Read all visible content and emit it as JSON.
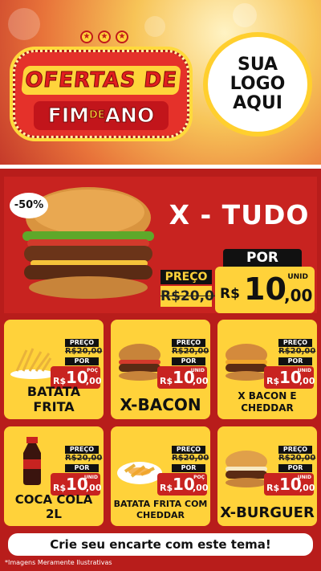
{
  "header": {
    "banner_line1": "OFERTAS DE",
    "banner_line2a": "FIM",
    "banner_de": "DE",
    "banner_line2b": "ANO",
    "logo": [
      "SUA",
      "LOGO",
      "AQUI"
    ]
  },
  "hero": {
    "discount": "-50%",
    "title": "X - TUDO",
    "preco_label": "PREÇO",
    "old_price": "R$20,00",
    "por_label": "POR",
    "currency": "R$",
    "price_int": "10",
    "price_dec": ",00",
    "unit": "UNID"
  },
  "products": [
    {
      "name": "BATATA FRITA",
      "preco_label": "PREÇO",
      "old_price": "R$20,00",
      "por_label": "POR",
      "currency": "R$",
      "price_int": "10",
      "price_dec": ",00",
      "unit": "POÇ"
    },
    {
      "name": "X-BACON",
      "preco_label": "PREÇO",
      "old_price": "R$20,00",
      "por_label": "POR",
      "currency": "R$",
      "price_int": "10",
      "price_dec": ",00",
      "unit": "UNID"
    },
    {
      "name": "X BACON E CHEDDAR",
      "preco_label": "PREÇO",
      "old_price": "R$20,00",
      "por_label": "POR",
      "currency": "R$",
      "price_int": "10",
      "price_dec": ",00",
      "unit": "UNID"
    },
    {
      "name": "COCA COLA 2L",
      "preco_label": "PREÇO",
      "old_price": "R$20,00",
      "por_label": "POR",
      "currency": "R$",
      "price_int": "10",
      "price_dec": ",00",
      "unit": "UNID"
    },
    {
      "name": "BATATA FRITA COM CHEDDAR",
      "preco_label": "PREÇO",
      "old_price": "R$20,00",
      "por_label": "POR",
      "currency": "R$",
      "price_int": "10",
      "price_dec": ",00",
      "unit": "POÇ"
    },
    {
      "name": "X-BURGUER",
      "preco_label": "PREÇO",
      "old_price": "R$20,00",
      "por_label": "POR",
      "currency": "R$",
      "price_int": "10",
      "price_dec": ",00",
      "unit": "UNID"
    }
  ],
  "cta": "Crie seu encarte com este tema!",
  "disclaimer": "*Imagens Meramente Ilustrativas",
  "colors": {
    "red": "#b81d1b",
    "yellow": "#ffd23a",
    "black": "#111111"
  }
}
